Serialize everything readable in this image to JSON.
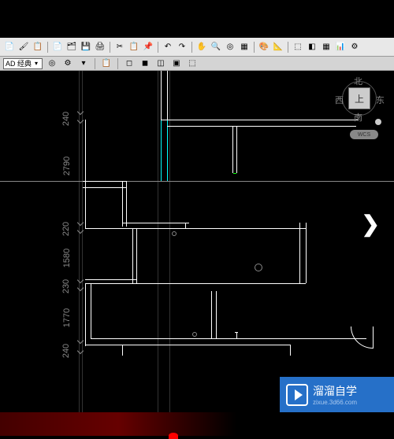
{
  "workspace": {
    "style_label": "AD 经典"
  },
  "dimensions": {
    "d1": "240",
    "d2": "2790",
    "d3": "220",
    "d4": "1580",
    "d5": "230",
    "d6": "1770",
    "d7": "240"
  },
  "viewcube": {
    "top": "北",
    "left": "西",
    "right": "东",
    "bottom": "南",
    "face": "上",
    "wcs": "WCS"
  },
  "navigation": {
    "next": "❯"
  },
  "watermark": {
    "title": "溜溜自学",
    "url": "zixue.3d66.com"
  }
}
